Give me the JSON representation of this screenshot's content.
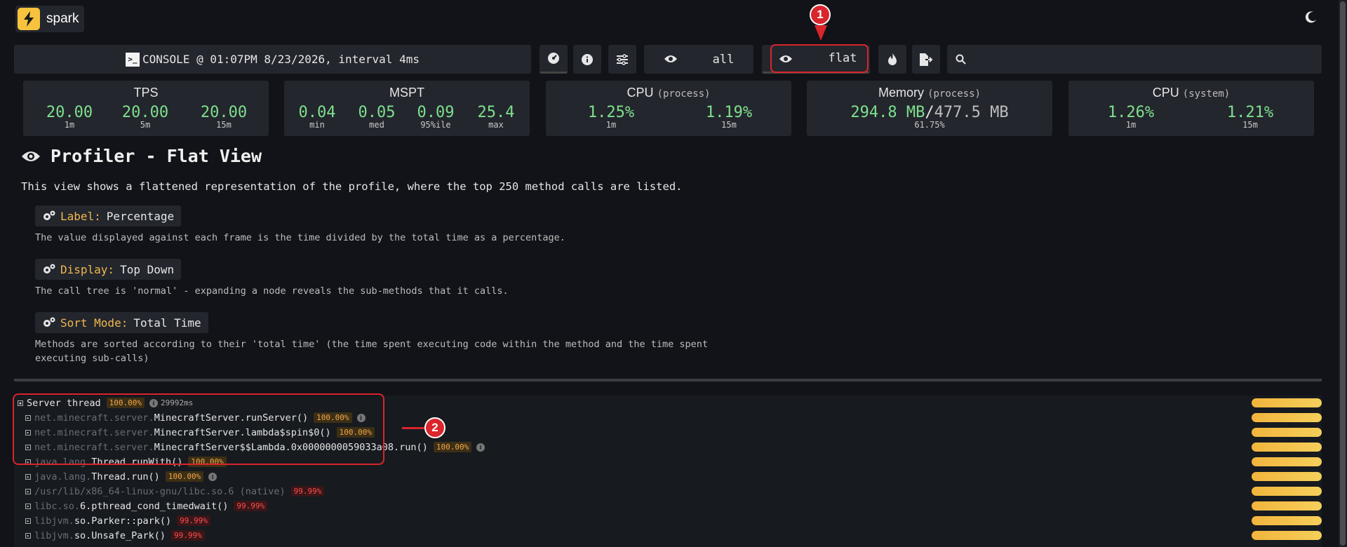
{
  "app": {
    "name": "spark"
  },
  "controls": {
    "console_text": "CONSOLE @ 01:07PM 8/23/2026, interval 4ms",
    "term_glyph": ">_",
    "all_label": "all",
    "flat_label": "flat",
    "search_placeholder": ""
  },
  "stats": {
    "tps": {
      "title": "TPS",
      "values": [
        {
          "v": "20.00",
          "l": "1m"
        },
        {
          "v": "20.00",
          "l": "5m"
        },
        {
          "v": "20.00",
          "l": "15m"
        }
      ]
    },
    "mspt": {
      "title": "MSPT",
      "values": [
        {
          "v": "0.04",
          "l": "min"
        },
        {
          "v": "0.05",
          "l": "med"
        },
        {
          "v": "0.09",
          "l": "95%ile"
        },
        {
          "v": "25.4",
          "l": "max"
        }
      ]
    },
    "cpu_process": {
      "title": "CPU",
      "sub": "(process)",
      "values": [
        {
          "v": "1.25%",
          "l": "1m"
        },
        {
          "v": "1.19%",
          "l": "15m"
        }
      ]
    },
    "memory": {
      "title": "Memory",
      "sub": "(process)",
      "used": "294.8 MB",
      "sep": "/",
      "total": "477.5 MB",
      "percent": "61.75%"
    },
    "cpu_system": {
      "title": "CPU",
      "sub": "(system)",
      "values": [
        {
          "v": "1.26%",
          "l": "1m"
        },
        {
          "v": "1.21%",
          "l": "15m"
        }
      ]
    }
  },
  "view": {
    "title": "Profiler - Flat View",
    "description": "This view shows a flattened representation of the profile, where the top 250 method calls are listed.",
    "settings": [
      {
        "key": "Label:",
        "value": "Percentage",
        "note": "The value displayed against each frame is the time divided by the total time as a percentage."
      },
      {
        "key": "Display:",
        "value": "Top Down",
        "note": "The call tree is 'normal' - expanding a node reveals the sub-methods that it calls."
      },
      {
        "key": "Sort Mode:",
        "value": "Total Time",
        "note": "Methods are sorted according to their 'total time' (the time spent executing code within the method and the time spent executing sub-calls)"
      }
    ]
  },
  "tree": {
    "rows": [
      {
        "pkg": "",
        "cls": "Server thread",
        "pct": "100.00%",
        "color": "orange",
        "info": true,
        "time": "29992ms",
        "expanded": true,
        "indent": 0
      },
      {
        "pkg": "net.minecraft.server.",
        "cls": "MinecraftServer.runServer()",
        "pct": "100.00%",
        "color": "orange",
        "info": true,
        "indent": 1
      },
      {
        "pkg": "net.minecraft.server.",
        "cls": "MinecraftServer.lambda$spin$0()",
        "pct": "100.00%",
        "color": "orange",
        "info": false,
        "indent": 1
      },
      {
        "pkg": "net.minecraft.server.",
        "cls": "MinecraftServer$$Lambda.0x0000000059033a08.run()",
        "pct": "100.00%",
        "color": "orange",
        "info": true,
        "indent": 1
      },
      {
        "pkg": "java.lang.",
        "cls": "Thread.runWith()",
        "pct": "100.00%",
        "color": "orange",
        "info": false,
        "indent": 1
      },
      {
        "pkg": "java.lang.",
        "cls": "Thread.run()",
        "pct": "100.00%",
        "color": "orange",
        "info": true,
        "indent": 1
      },
      {
        "pkg": "/usr/lib/x86_64-linux-gnu/libc.so.6 (native)",
        "cls": "",
        "pct": "99.99%",
        "color": "red",
        "info": false,
        "indent": 1
      },
      {
        "pkg": "libc.so.",
        "cls": "6.pthread_cond_timedwait()",
        "pct": "99.99%",
        "color": "red",
        "info": false,
        "indent": 1
      },
      {
        "pkg": "libjvm.",
        "cls": "so.Parker::park()",
        "pct": "99.99%",
        "color": "red",
        "info": false,
        "indent": 1
      },
      {
        "pkg": "libjvm.",
        "cls": "so.Unsafe_Park()",
        "pct": "99.99%",
        "color": "red",
        "info": false,
        "indent": 1
      }
    ]
  },
  "callouts": [
    "1",
    "2"
  ],
  "colors": {
    "accent": "#f7c23d",
    "callout": "#d9252b",
    "green": "#7ee08d",
    "label_key": "#f2b84b"
  }
}
